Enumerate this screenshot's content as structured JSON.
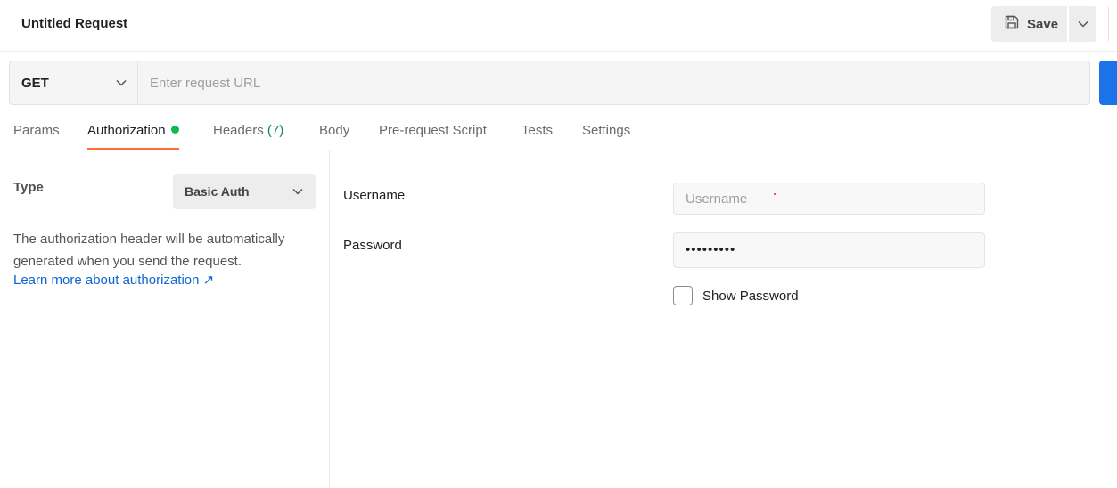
{
  "header": {
    "title": "Untitled Request",
    "save_label": "Save"
  },
  "request": {
    "method": "GET",
    "url_value": "",
    "url_placeholder": "Enter request URL"
  },
  "tabs": [
    {
      "label": "Params"
    },
    {
      "label": "Authorization",
      "active": true,
      "indicator": "green-dot"
    },
    {
      "label": "Headers",
      "count": "(7)"
    },
    {
      "label": "Body"
    },
    {
      "label": "Pre-request Script"
    },
    {
      "label": "Tests"
    },
    {
      "label": "Settings"
    }
  ],
  "auth": {
    "type_label": "Type",
    "type_value": "Basic Auth",
    "description": "The authorization header will be automatically generated when you send the request.",
    "learn_more": "Learn more about authorization ↗",
    "username_label": "Username",
    "username_placeholder": "Username",
    "username_value": "",
    "password_label": "Password",
    "password_masked": "•••••••••",
    "show_password_label": "Show Password",
    "show_password_checked": false
  },
  "colors": {
    "accent": "#ff6c37",
    "send_button": "#1a73e8",
    "link": "#0b66d1",
    "status_dot": "#0cbb52",
    "headers_count": "#0c8a45"
  },
  "icons": [
    "save-icon",
    "chevron-down-icon",
    "external-link-icon"
  ]
}
